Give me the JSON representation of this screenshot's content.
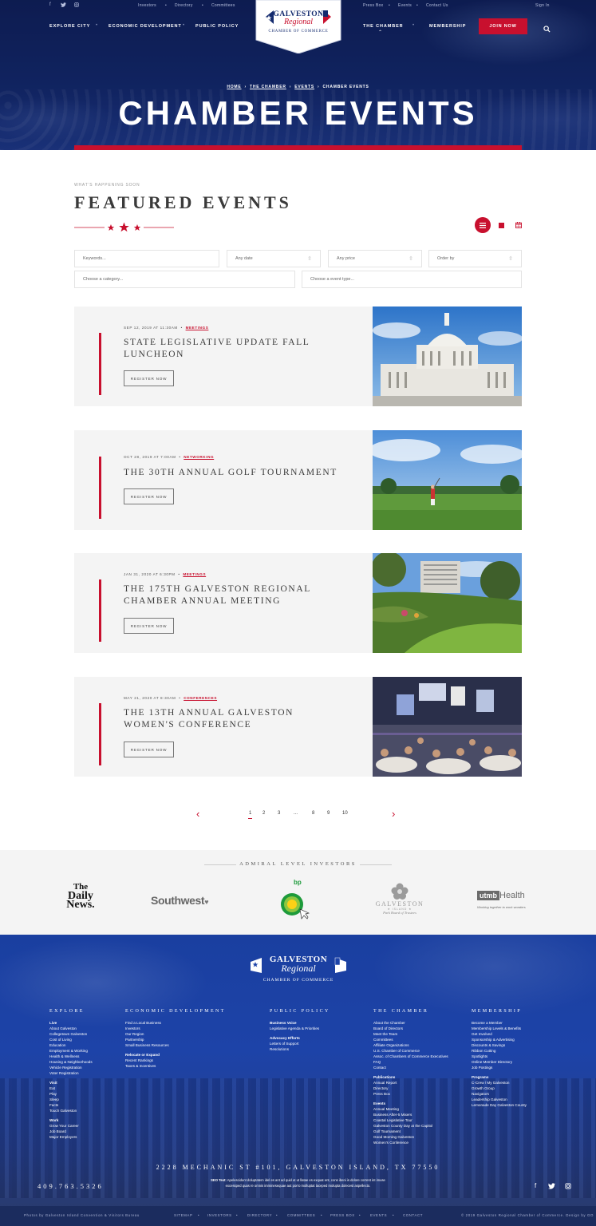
{
  "topbar": {
    "left": [
      "Investors",
      "Directory",
      "Committees"
    ],
    "right": [
      "Press Box",
      "Events",
      "Contact Us"
    ],
    "signin": "Sign In"
  },
  "nav": {
    "left": [
      "EXPLORE CITY",
      "ECONOMIC DEVELOPMENT",
      "PUBLIC POLICY"
    ],
    "right": [
      "THE CHAMBER",
      "MEMBERSHIP"
    ],
    "join": "JOIN NOW"
  },
  "logo": {
    "line1": "GALVESTON",
    "line2": "Regional",
    "line3": "CHAMBER OF COMMERCE"
  },
  "breadcrumb": [
    "HOME",
    "THE CHAMBER",
    "EVENTS",
    "CHAMBER EVENTS"
  ],
  "hero_title": "CHAMBER EVENTS",
  "featured": {
    "kicker": "WHAT'S HAPPENING SOON",
    "title": "FEATURED EVENTS"
  },
  "filters": {
    "keywords": "Keywords...",
    "date": "Any date",
    "price": "Any price",
    "order": "Order by",
    "category": "Choose a category...",
    "type": "Choose a event type..."
  },
  "events": [
    {
      "date": "SEP 12, 2019 AT 11:30AM",
      "category": "MEETINGS",
      "title": "STATE LEGISLATIVE UPDATE FALL LUNCHEON",
      "button": "REGISTER NOW"
    },
    {
      "date": "OCT 28, 2019 AT 7:00AM",
      "category": "NETWORKING",
      "title": "THE 30TH ANNUAL GOLF TOURNAMENT",
      "button": "REGISTER NOW"
    },
    {
      "date": "JAN 31, 2020 AT 6:30PM",
      "category": "MEETINGS",
      "title": "THE 175TH GALVESTON REGIONAL CHAMBER ANNUAL MEETING",
      "button": "REGISTER NOW"
    },
    {
      "date": "MAY 21, 2020 AT 8:30AM",
      "category": "CONFERENCES",
      "title": "THE 13TH ANNUAL GALVESTON WOMEN'S CONFERENCE",
      "button": "REGISTER NOW"
    }
  ],
  "pagination": {
    "pages": [
      "1",
      "2",
      "3",
      "...",
      "8",
      "9",
      "10"
    ],
    "current": "1"
  },
  "investors": {
    "title": "ADMIRAL LEVEL INVESTORS",
    "daily_news": [
      "The",
      "Daily",
      "News."
    ],
    "southwest": "Southwest",
    "bp": "bp",
    "galveston": [
      "GALVESTON",
      "★ ISLAND ★",
      "Park Board of Trustees"
    ],
    "utmb": [
      "utmb",
      "Health",
      "Working together to work wonders"
    ]
  },
  "footer": {
    "columns": [
      {
        "heading": "EXPLORE",
        "groups": [
          {
            "title": "Live",
            "items": [
              "About Galveston",
              "Collegetown Galveston",
              "Cost of Living",
              "Education",
              "Employment & Working",
              "Health & Wellness",
              "Housing & Neighborhoods",
              "Vehicle Registration",
              "Voter Registration"
            ]
          },
          {
            "title": "Visit",
            "items": [
              "Eat",
              "Play",
              "Sleep",
              "Facts",
              "Touch Galveston"
            ]
          },
          {
            "title": "Work",
            "items": [
              "Grow Your Career",
              "Job Board",
              "Major Employers"
            ]
          }
        ]
      },
      {
        "heading": "ECONOMIC DEVELOPMENT",
        "groups": [
          {
            "title": "",
            "items": [
              "Find a Local Business",
              "Investors",
              "Our Region",
              "Partnership",
              "Small Business Resources"
            ]
          },
          {
            "title": "Relocate or Expand",
            "items": [
              "Recent Rankings",
              "Taxes & Incentives"
            ]
          }
        ]
      },
      {
        "heading": "PUBLIC POLICY",
        "groups": [
          {
            "title": "Business Voice",
            "items": [
              "Legislative Agenda & Priorities"
            ]
          },
          {
            "title": "Advocacy Efforts",
            "items": [
              "Letters of Support",
              "Resolutions"
            ]
          }
        ]
      },
      {
        "heading": "THE CHAMBER",
        "groups": [
          {
            "title": "",
            "items": [
              "About the Chamber",
              "Board of Directors",
              "Meet the Team",
              "Committees",
              "Affiliate Organizations",
              "U.S. Chamber of Commerce",
              "Assoc. of Chambers of Commerce Executives",
              "FAQ",
              "Contact"
            ]
          },
          {
            "title": "Publications",
            "items": [
              "Annual Report",
              "Directory",
              "Press Box"
            ]
          },
          {
            "title": "Events",
            "items": [
              "Annual Meeting",
              "Business After-5 Mixers",
              "Coastal Legislative Tour",
              "Galveston County Day at the Capitol",
              "Golf Tournament",
              "Good Morning Galveston",
              "Women's Conference"
            ]
          }
        ]
      },
      {
        "heading": "MEMBERSHIP",
        "groups": [
          {
            "title": "",
            "items": [
              "Become a Member",
              "Membership Levels & Benefits",
              "Get Involved",
              "Sponsorship & Advertising",
              "Discounts & Savings",
              "Ribbon Cutting",
              "Spotlights",
              "Online Member Directory",
              "Job Postings"
            ]
          },
          {
            "title": "Programs",
            "items": [
              "C-Crew / My Galveston",
              "Growth Group",
              "Navigators",
              "Leadership Galveston",
              "Lemonade Day Galveston County"
            ]
          }
        ]
      }
    ],
    "address": "2228 MECHANIC ST #101, GALVESTON ISLAND, TX 77550",
    "seo_label": "SEO Text:",
    "seo_text1": "Apelescidunt doluptatem idel es ant ad quid ut ut llatae es exquat ent, cons ibeni is dolore corrent int imuse",
    "seo_text2": "excessped quas re omnis imminesequae aut porro molluptat laceped molupta dolecest aspellecto.",
    "phone": "409.763.5326",
    "credit": "Photos by Galveston Island Convention & Visitors Bureau",
    "links": [
      "SITEMAP",
      "INVESTORS",
      "DIRECTORY",
      "COMMITTEES",
      "PRESS BOX",
      "EVENTS",
      "CONTACT"
    ],
    "copyright": "© 2019 Galveston Regional Chamber of Commerce. Design by GO"
  },
  "colors": {
    "navy": "#132a6e",
    "red": "#c8102e",
    "footer_blue": "#1d43a8",
    "card_bg": "#f4f4f4"
  }
}
